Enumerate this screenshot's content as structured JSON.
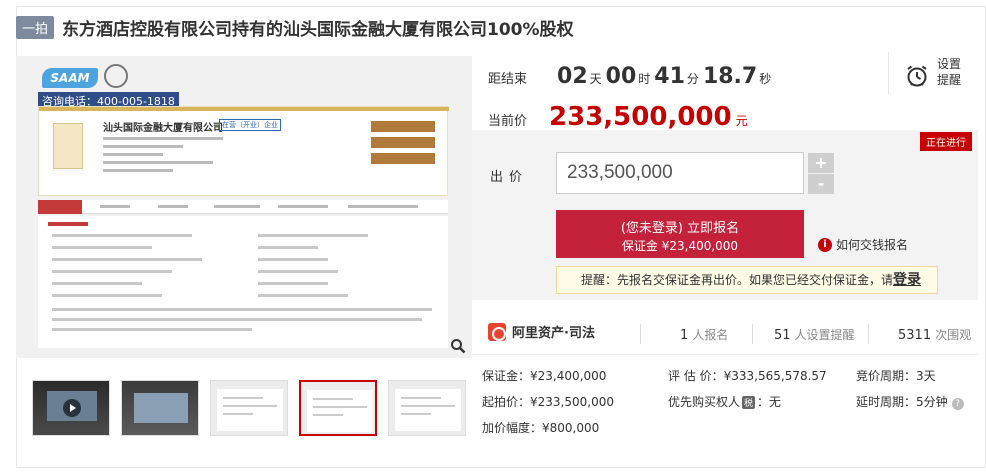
{
  "header": {
    "tag": "一拍",
    "title": "东方酒店控股有限公司持有的汕头国际金融大厦有限公司100%股权"
  },
  "gallery": {
    "logo_text": "SAAM",
    "hotline": "咨询电话：400-005-1818",
    "company_name": "汕头国际金融大厦有限公司",
    "company_tag": "在营（开业）企业",
    "thumbnails": [
      "video",
      "photo",
      "document",
      "document-active",
      "document"
    ]
  },
  "countdown": {
    "label": "距结束",
    "days": "02",
    "days_unit": "天",
    "hours": "00",
    "hours_unit": "时",
    "minutes": "41",
    "minutes_unit": "分",
    "seconds": "18.7",
    "seconds_unit": "秒"
  },
  "remind": {
    "label": "设置提醒",
    "icon": "alarm-clock-icon"
  },
  "current_price": {
    "label": "当前价",
    "value": "233,500,000",
    "unit": "元"
  },
  "bid": {
    "status": "正在进行",
    "label": "出价",
    "input_value": "233,500,000",
    "plus": "+",
    "minus": "-",
    "enroll_line1": "(您未登录) 立即报名",
    "enroll_line2": "保证金 ¥23,400,000",
    "how_to": "如何交钱报名",
    "notice_text": "提醒：先报名交保证金再出价。如果您已经交付保证金，请",
    "notice_link": "登录"
  },
  "stats": {
    "brand": "阿里资产·司法",
    "enrolled_count": "1",
    "enrolled_unit": "人报名",
    "reminder_count": "51",
    "reminder_unit": "人设置提醒",
    "views_count": "5311",
    "views_unit": "次围观"
  },
  "details": {
    "deposit": "保证金：¥23,400,000",
    "appraisal": "评 估 价：¥333,565,578.57",
    "bidding_cycle": "竞价周期：3天",
    "starting_price": "起拍价：¥233,500,000",
    "priority_label": "优先购买权人",
    "priority_badge": "税",
    "priority_value": "：无",
    "delay_cycle": "延时周期：5分钟",
    "increment": "加价幅度：¥800,000"
  },
  "colors": {
    "accent": "#c40000",
    "button": "#c4213a"
  }
}
